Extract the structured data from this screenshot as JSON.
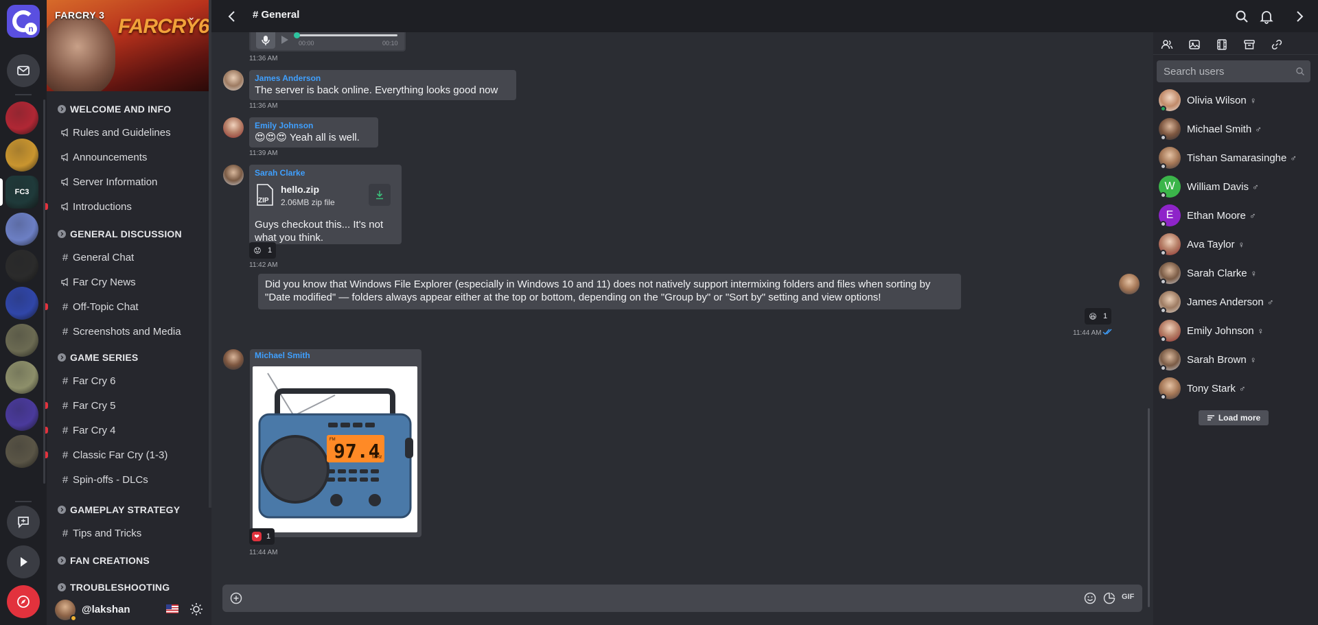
{
  "rail": {
    "logo_letter": "n",
    "servers": [
      {
        "name": "server-need-for-speed",
        "color": "#b02734",
        "label": ""
      },
      {
        "name": "server-clash-of-clans",
        "color": "#c9952f",
        "label": ""
      },
      {
        "name": "server-far-cry-3",
        "color": "#1f3a3a",
        "label": "FC3"
      },
      {
        "name": "server-apex",
        "color": "#6c7fc4",
        "label": ""
      },
      {
        "name": "server-call-of-duty",
        "color": "#2b2b2b",
        "label": ""
      },
      {
        "name": "server-destiny",
        "color": "#3046a8",
        "label": ""
      },
      {
        "name": "server-battlefield",
        "color": "#6b6a52",
        "label": ""
      },
      {
        "name": "server-pubg",
        "color": "#8d8f6a",
        "label": ""
      },
      {
        "name": "server-fortnite",
        "color": "#4a3a9c",
        "label": ""
      },
      {
        "name": "server-tomb-raider",
        "color": "#5a5546",
        "label": ""
      }
    ]
  },
  "sidebar": {
    "banner": {
      "left_title": "FARCRY 3",
      "right_title": "FARCRY6"
    },
    "categories": [
      {
        "label": "WELCOME AND INFO",
        "channels": [
          {
            "label": "Rules and Guidelines",
            "icon": "megaphone",
            "unread": false
          },
          {
            "label": "Announcements",
            "icon": "megaphone",
            "unread": false
          },
          {
            "label": "Server Information",
            "icon": "megaphone",
            "unread": false
          },
          {
            "label": "Introductions",
            "icon": "megaphone",
            "unread": true
          }
        ]
      },
      {
        "label": "GENERAL DISCUSSION",
        "channels": [
          {
            "label": "General Chat",
            "icon": "hash",
            "unread": false
          },
          {
            "label": "Far Cry News",
            "icon": "megaphone",
            "unread": false
          },
          {
            "label": "Off-Topic Chat",
            "icon": "hash-thread",
            "unread": true
          },
          {
            "label": "Screenshots and Media",
            "icon": "hash",
            "unread": false
          }
        ]
      },
      {
        "label": "GAME SERIES",
        "channels": [
          {
            "label": "Far Cry 6",
            "icon": "hash",
            "unread": false
          },
          {
            "label": "Far Cry 5",
            "icon": "hash",
            "unread": true
          },
          {
            "label": "Far Cry 4",
            "icon": "hash",
            "unread": true
          },
          {
            "label": "Classic Far Cry (1-3)",
            "icon": "hash",
            "unread": true
          },
          {
            "label": "Spin-offs - DLCs",
            "icon": "hash",
            "unread": false
          }
        ]
      },
      {
        "label": "GAMEPLAY STRATEGY",
        "channels": [
          {
            "label": "Tips and Tricks",
            "icon": "hash",
            "unread": false
          }
        ]
      },
      {
        "label": "FAN CREATIONS",
        "channels": []
      },
      {
        "label": "TROUBLESHOOTING",
        "channels": []
      }
    ],
    "user": {
      "handle": "@lakshan",
      "status": "idle"
    }
  },
  "header": {
    "channel": "# General"
  },
  "chat": {
    "voice": {
      "start": "00:00",
      "end": "00:10",
      "time": "11:36 AM",
      "progress": 0.0
    },
    "messages": [
      {
        "author": "James Anderson",
        "text": "The server is back online. Everything looks good now",
        "time": "11:36 AM"
      },
      {
        "author": "Emily Johnson",
        "text": "Yeah all is well.",
        "emojis": "😍😍😍",
        "time": "11:39 AM"
      },
      {
        "author": "Sarah Clarke",
        "file_name": "hello.zip",
        "file_size": "2.06MB zip file",
        "text": "Guys checkout this... It's not what you think.",
        "reaction": {
          "emoji": "😟",
          "count": "1"
        },
        "time": "11:42 AM"
      },
      {
        "author": "me",
        "text": "Did you know that Windows File Explorer (especially in Windows 10 and 11) does not natively support intermixing folders and files when sorting by \"Date modified\" — folders always appear either at the top or bottom, depending on the \"Group by\" or \"Sort by\" setting and view options!",
        "reaction": {
          "emoji": "😆",
          "count": "1"
        },
        "time": "11:44 AM"
      },
      {
        "author": "Michael Smith",
        "image": {
          "frequency": "97.4",
          "unit": "MHz",
          "band": "FM"
        },
        "reaction": {
          "emoji": "❤",
          "count": "1"
        },
        "time": "11:44 AM"
      }
    ],
    "composer": {
      "placeholder": "",
      "gif_label": "GIF"
    }
  },
  "members": {
    "search_placeholder": "Search users",
    "list": [
      {
        "name": "Olivia Wilson",
        "gender": "♀",
        "online": true,
        "initial": "",
        "color": ""
      },
      {
        "name": "Michael Smith",
        "gender": "♂",
        "online": false,
        "initial": "",
        "color": ""
      },
      {
        "name": "Tishan Samarasinghe",
        "gender": "♂",
        "online": false,
        "initial": "",
        "color": ""
      },
      {
        "name": "William Davis",
        "gender": "♂",
        "online": false,
        "initial": "W",
        "color": "#3bb54a"
      },
      {
        "name": "Ethan Moore",
        "gender": "♂",
        "online": false,
        "initial": "E",
        "color": "#8e24c9"
      },
      {
        "name": "Ava Taylor",
        "gender": "♀",
        "online": false,
        "initial": "",
        "color": ""
      },
      {
        "name": "Sarah Clarke",
        "gender": "♀",
        "online": false,
        "initial": "",
        "color": ""
      },
      {
        "name": "James Anderson",
        "gender": "♂",
        "online": false,
        "initial": "",
        "color": ""
      },
      {
        "name": "Emily Johnson",
        "gender": "♀",
        "online": false,
        "initial": "",
        "color": ""
      },
      {
        "name": "Sarah Brown",
        "gender": "♀",
        "online": false,
        "initial": "",
        "color": ""
      },
      {
        "name": "Tony Stark",
        "gender": "♂",
        "online": false,
        "initial": "",
        "color": ""
      }
    ],
    "load_more": "Load more"
  }
}
